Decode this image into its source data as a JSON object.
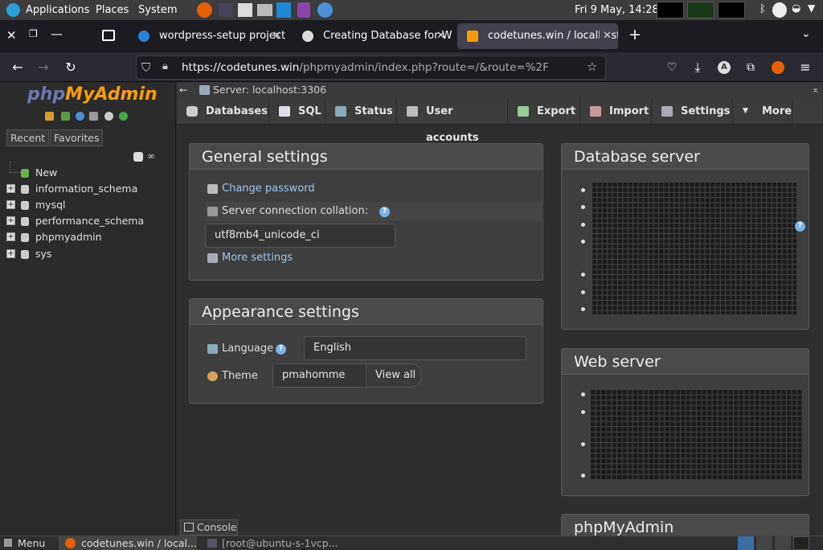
{
  "os_panel": {
    "applications": "Applications",
    "places": "Places",
    "system": "System",
    "clock": "Fri  9 May, 14:28"
  },
  "tabs": [
    {
      "title": "wordpress-setup project",
      "active": false
    },
    {
      "title": "Creating Database for Wo",
      "active": false
    },
    {
      "title": "codetunes.win / localhost",
      "active": true
    }
  ],
  "address_bar": {
    "host": "https://codetunes.win",
    "path": "/phpmyadmin/index.php?route=/&route=%2F"
  },
  "sidebar": {
    "logo_php": "php",
    "logo_myadmin": "MyAdmin",
    "recent": "Recent",
    "favorites": "Favorites",
    "new_label": "New",
    "databases": [
      "information_schema",
      "mysql",
      "performance_schema",
      "phpmyadmin",
      "sys"
    ]
  },
  "server_bar": {
    "label": "Server: localhost:3306"
  },
  "menu": [
    "Databases",
    "SQL",
    "Status",
    "User accounts",
    "Export",
    "Import",
    "Settings",
    "More"
  ],
  "general_settings": {
    "title": "General settings",
    "change_password": "Change password",
    "collation_label": "Server connection collation:",
    "collation_value": "utf8mb4_unicode_ci",
    "more_settings": "More settings"
  },
  "appearance_settings": {
    "title": "Appearance settings",
    "language_label": "Language",
    "language_value": "English",
    "theme_label": "Theme",
    "theme_value": "pmahomme",
    "view_all": "View all"
  },
  "database_server": {
    "title": "Database server"
  },
  "web_server": {
    "title": "Web server"
  },
  "phpmyadmin_panel": {
    "title": "phpMyAdmin"
  },
  "console": {
    "label": "Console"
  },
  "taskbar": {
    "menu": "Menu",
    "window1": "codetunes.win / local...",
    "window2": "[root@ubuntu-s-1vcp..."
  },
  "colors": {
    "logo_blue": "#6c78af",
    "logo_orange": "#f89c0e",
    "help_blue": "#7ab4e6"
  }
}
